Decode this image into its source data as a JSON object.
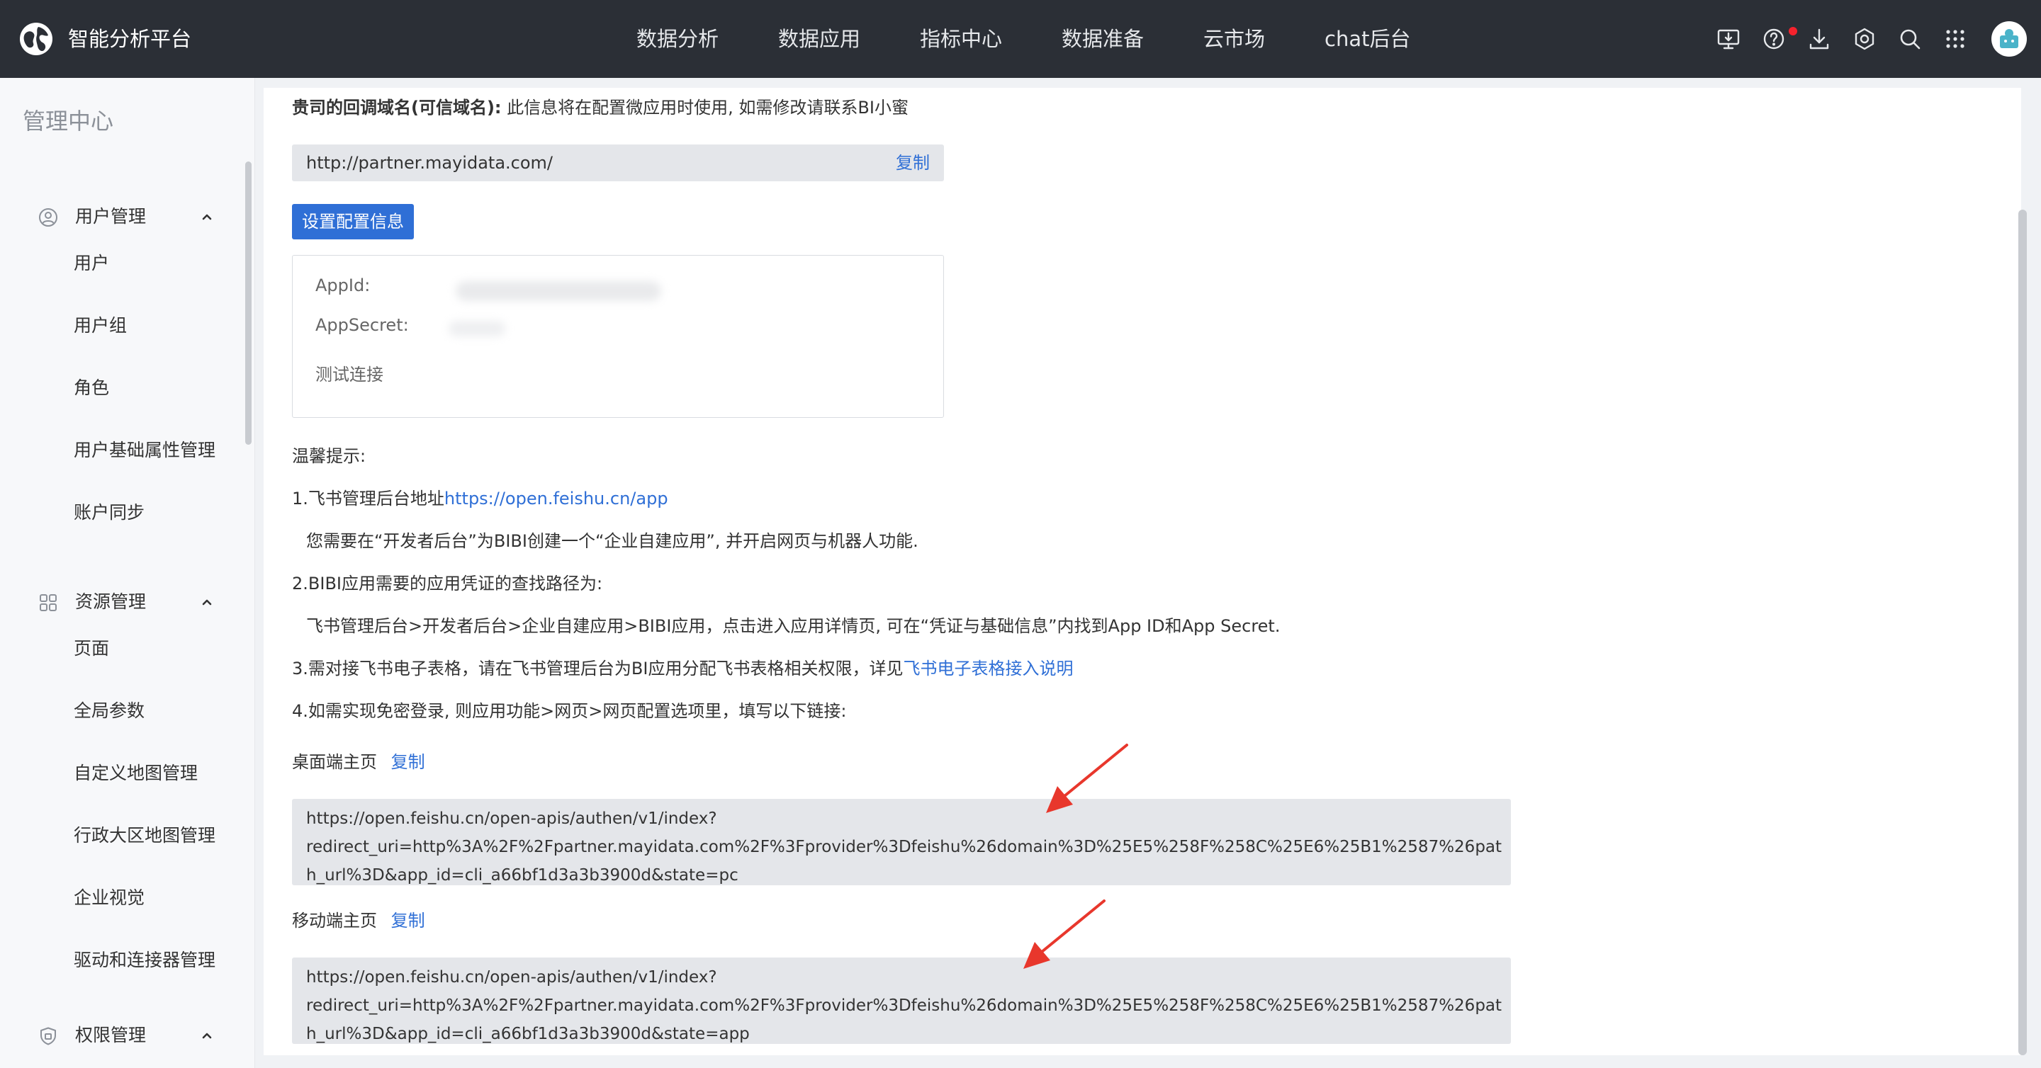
{
  "header": {
    "app_title": "智能分析平台",
    "nav": [
      "数据分析",
      "数据应用",
      "指标中心",
      "数据准备",
      "云市场",
      "chat后台"
    ],
    "tool_icons": [
      "desktop-download-icon",
      "help-icon",
      "download-icon",
      "settings-icon",
      "search-icon",
      "apps-grid-icon"
    ],
    "notification_dot_color": "#f5222d"
  },
  "sidebar": {
    "title": "管理中心",
    "groups": [
      {
        "label": "用户管理",
        "icon": "user-circle-icon",
        "items": [
          "用户",
          "用户组",
          "角色",
          "用户基础属性管理",
          "账户同步"
        ]
      },
      {
        "label": "资源管理",
        "icon": "resource-grid-icon",
        "items": [
          "页面",
          "全局参数",
          "自定义地图管理",
          "行政大区地图管理",
          "企业视觉",
          "驱动和连接器管理"
        ]
      },
      {
        "label": "权限管理",
        "icon": "shield-icon",
        "items": []
      }
    ]
  },
  "main": {
    "domain_label": "贵司的回调域名(可信域名):",
    "domain_desc": " 此信息将在配置微应用时使用, 如需修改请联系BI小蜜",
    "domain_url": "http://partner.mayidata.com/",
    "copy_label": "复制",
    "config_button": "设置配置信息",
    "appid_label": "AppId:",
    "appsecret_label": "AppSecret:",
    "test_connection": "测试连接",
    "tips_title": "温馨提示:",
    "tip1_prefix": "1.飞书管理后台地址",
    "tip1_link": "https://open.feishu.cn/app",
    "tip1_detail": "您需要在“开发者后台”为BIBI创建一个“企业自建应用”, 并开启网页与机器人功能.",
    "tip2": "2.BIBI应用需要的应用凭证的查找路径为:",
    "tip2_detail": "飞书管理后台>开发者后台>企业自建应用>BIBI应用，点击进入应用详情页, 可在“凭证与基础信息”内找到App ID和App Secret.",
    "tip3_prefix": "3.需对接飞书电子表格，请在飞书管理后台为BI应用分配飞书表格相关权限，详见",
    "tip3_link": "飞书电子表格接入说明",
    "tip4": "4.如需实现免密登录, 则应用功能>网页>网页配置选项里，填写以下链接:",
    "desktop_label": "桌面端主页",
    "desktop_url_lines": [
      "https://open.feishu.cn/open-apis/authen/v1/index?",
      "redirect_uri=http%3A%2F%2Fpartner.mayidata.com%2F%3Fprovider%3Dfeishu%26domain%3D%25E5%258F%258C%25E6%25B1%2587%26pat",
      "h_url%3D&app_id=cli_a66bf1d3a3b3900d&state=pc"
    ],
    "mobile_label": "移动端主页",
    "mobile_url_lines": [
      "https://open.feishu.cn/open-apis/authen/v1/index?",
      "redirect_uri=http%3A%2F%2Fpartner.mayidata.com%2F%3Fprovider%3Dfeishu%26domain%3D%25E5%258F%258C%25E6%25B1%2587%26pat",
      "h_url%3D&app_id=cli_a66bf1d3a3b3900d&state=app"
    ]
  },
  "colors": {
    "topbar_bg": "#2b2f36",
    "accent": "#2f6fd6",
    "annotation_arrow": "#e8372c"
  }
}
